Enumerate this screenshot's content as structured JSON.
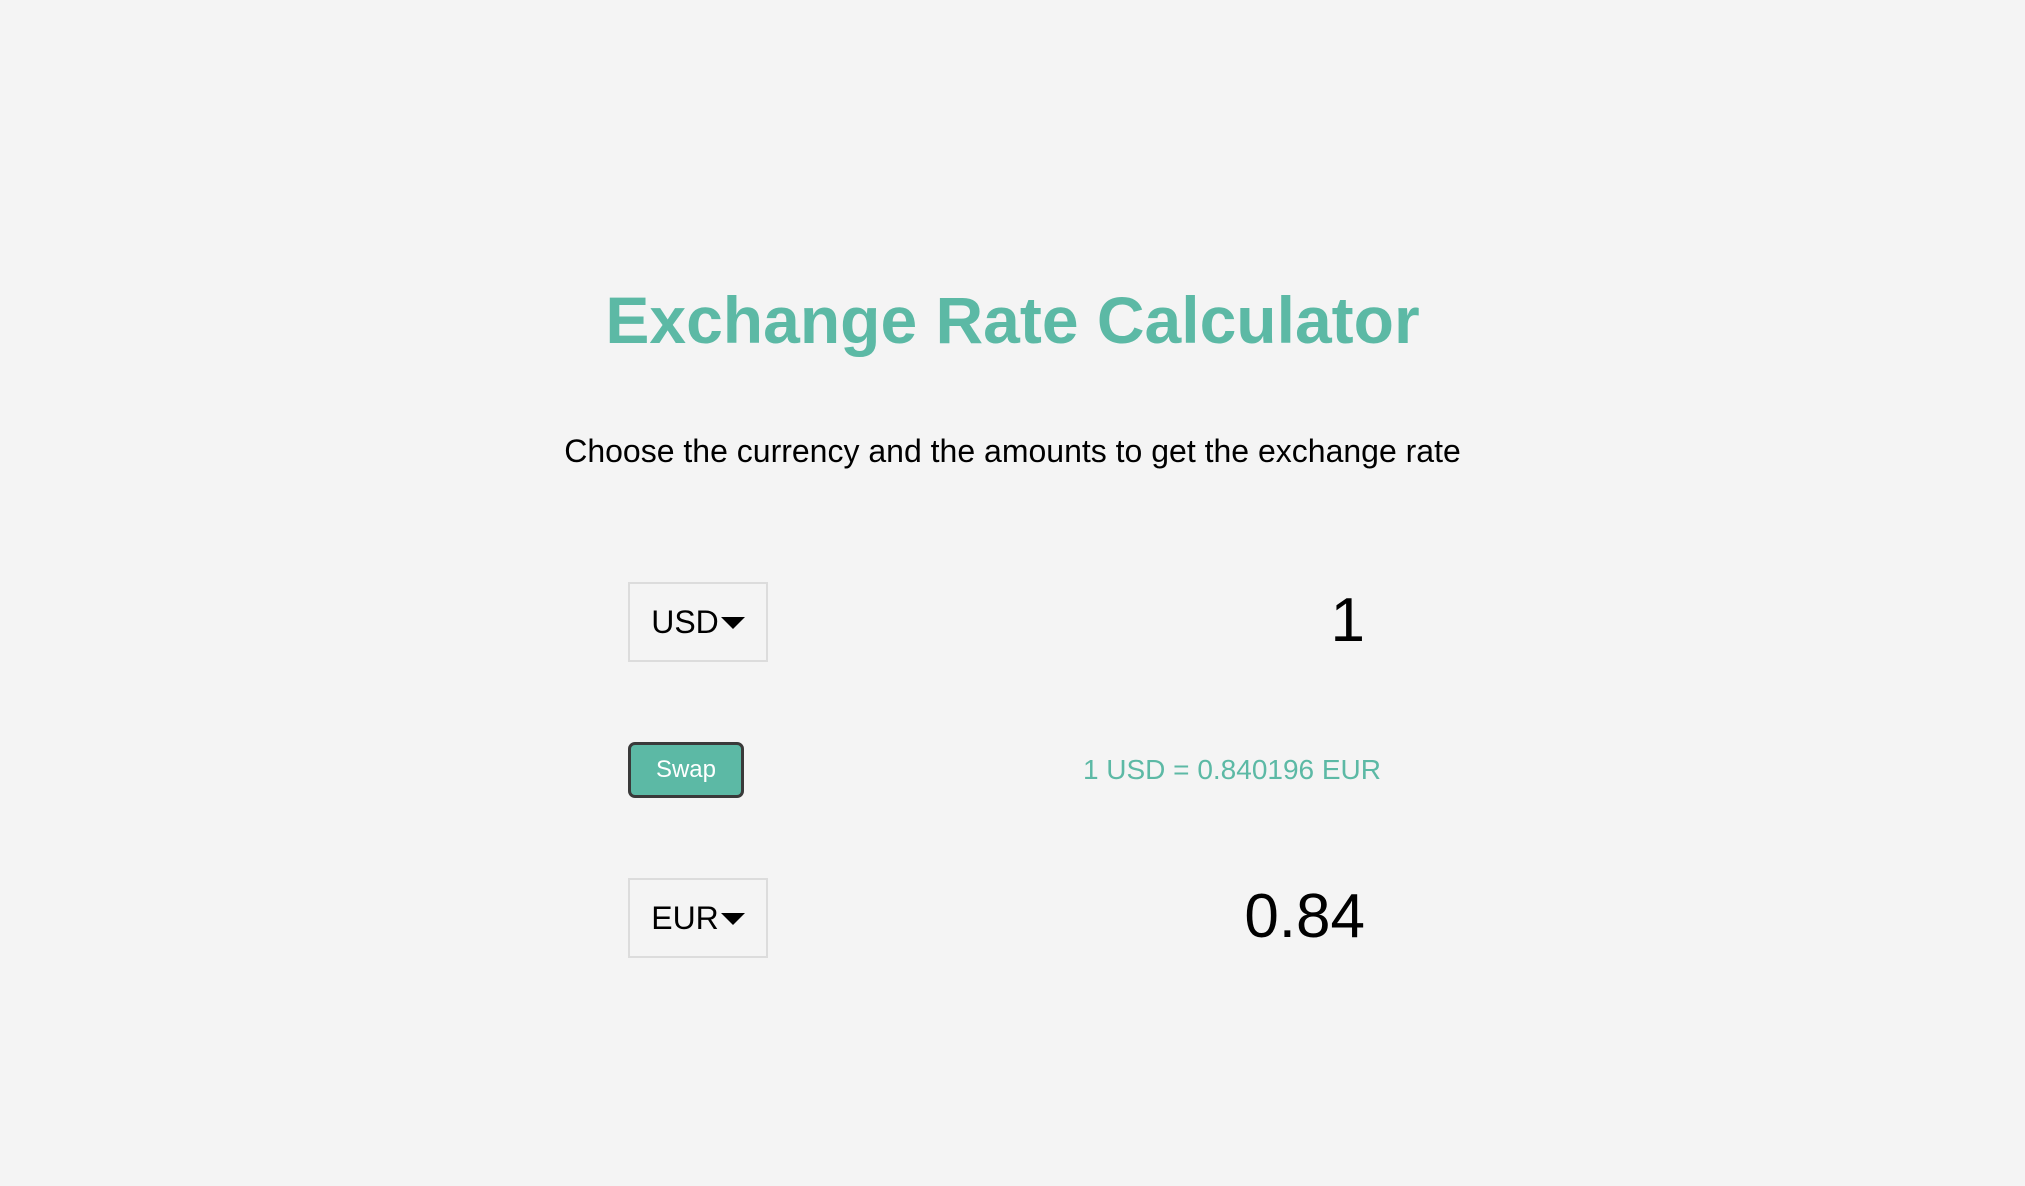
{
  "header": {
    "title": "Exchange Rate Calculator",
    "subtitle": "Choose the currency and the amounts to get the exchange rate"
  },
  "converter": {
    "currency_one": {
      "code": "USD",
      "amount": "1"
    },
    "swap_label": "Swap",
    "rate_text": "1 USD = 0.840196 EUR",
    "currency_two": {
      "code": "EUR",
      "amount": "0.84"
    }
  },
  "colors": {
    "accent": "#5cb9a5",
    "background": "#f4f4f4",
    "text": "#000000",
    "select_border": "#dcdcdc",
    "button_border": "#3a3a3a"
  },
  "icons": {
    "dropdown": "caret-down-icon"
  }
}
